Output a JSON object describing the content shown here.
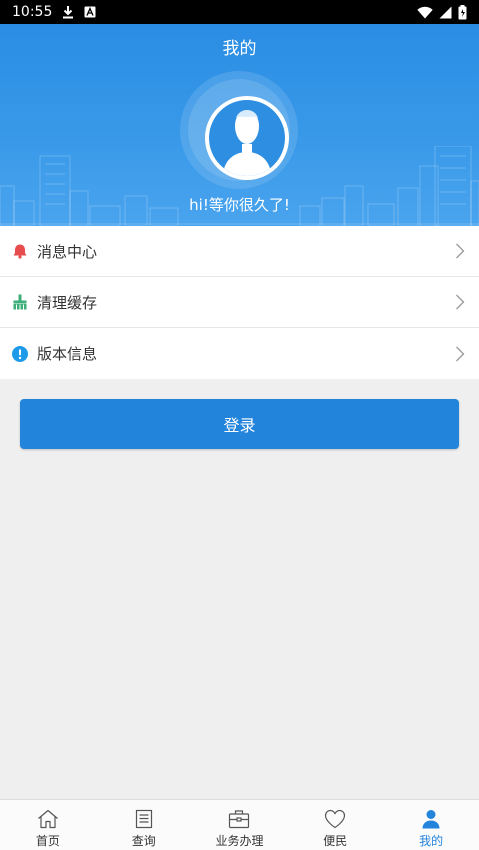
{
  "status_bar": {
    "time": "10:55",
    "icons": [
      "download-icon",
      "a-icon",
      "wifi-icon",
      "signal-icon",
      "battery-icon"
    ]
  },
  "header": {
    "title": "我的",
    "greeting": "hi!等你很久了!"
  },
  "menu": {
    "items": [
      {
        "label": "消息中心",
        "icon": "bell-icon",
        "icon_color": "#e84d4d"
      },
      {
        "label": "清理缓存",
        "icon": "broom-icon",
        "icon_color": "#3dae7a"
      },
      {
        "label": "版本信息",
        "icon": "info-icon",
        "icon_color": "#1e9be8"
      }
    ]
  },
  "login_button": {
    "label": "登录"
  },
  "tabbar": {
    "tabs": [
      {
        "label": "首页",
        "icon": "home-icon"
      },
      {
        "label": "查询",
        "icon": "document-icon"
      },
      {
        "label": "业务办理",
        "icon": "briefcase-icon"
      },
      {
        "label": "便民",
        "icon": "heart-icon"
      },
      {
        "label": "我的",
        "icon": "user-icon",
        "active": true
      }
    ]
  },
  "colors": {
    "primary": "#2384dc",
    "header": "#2a8de3",
    "background": "#efefef"
  }
}
